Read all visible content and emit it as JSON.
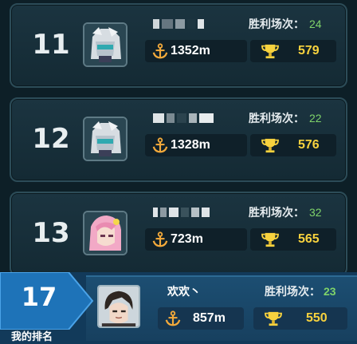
{
  "colors": {
    "wins_number": "#7fd36a",
    "trophy": "#f7d23e",
    "anchor": "#f2a93b",
    "self_bar": "#123a5a",
    "pentagon": "#1e73b8"
  },
  "wins_label": "胜利场次：",
  "rows": [
    {
      "rank": "11",
      "distance": "1352m",
      "trophies": "579",
      "wins": "24",
      "avatar": "silver-hair-mask-knight"
    },
    {
      "rank": "12",
      "distance": "1328m",
      "trophies": "576",
      "wins": "22",
      "avatar": "silver-hair-mask-knight"
    },
    {
      "rank": "13",
      "distance": "723m",
      "trophies": "565",
      "wins": "32",
      "avatar": "pink-hair-girl"
    }
  ],
  "self": {
    "rank": "17",
    "rank_label": "我的排名",
    "name": "欢欢丶",
    "distance": "857m",
    "trophies": "550",
    "wins": "23",
    "avatar": "dark-hair-boy"
  }
}
